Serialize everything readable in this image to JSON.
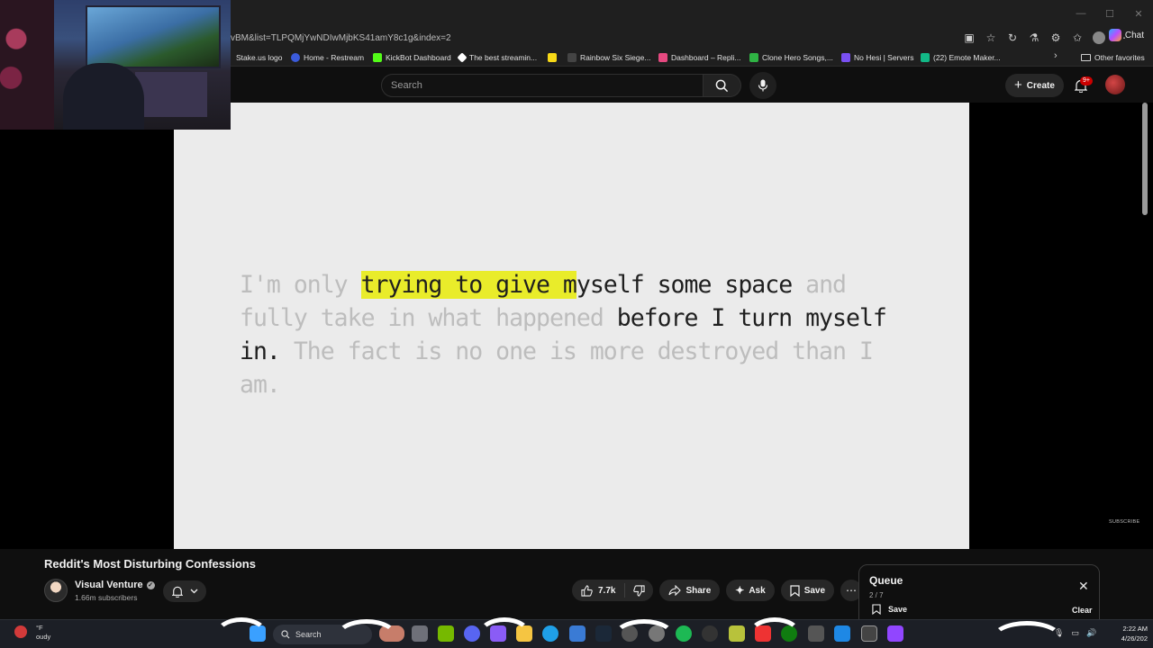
{
  "browser": {
    "url_text": "vBM&list=TLPQMjYwNDIwMjbKS41amY8c1g&index=2",
    "chat_label": "Chat",
    "bookmarks": [
      {
        "label": "Stake.us logo",
        "color": "#1f1f1f"
      },
      {
        "label": "Home - Restream",
        "color": "#3b5bdb"
      },
      {
        "label": "KickBot Dashboard",
        "color": "#53fc18"
      },
      {
        "label": "The best streamin...",
        "color": "#ffffff"
      },
      {
        "label": "",
        "color": "#f7d917"
      },
      {
        "label": "Rainbow Six Siege...",
        "color": "#444444"
      },
      {
        "label": "Dashboard – Repli...",
        "color": "#e64980"
      },
      {
        "label": "Clone Hero Songs,...",
        "color": "#2fb344"
      },
      {
        "label": "No Hesi | Servers",
        "color": "#7950f2"
      },
      {
        "label": "(22) Emote Maker...",
        "color": "#12b886"
      }
    ],
    "other_favorites": "Other favorites"
  },
  "youtube": {
    "search_placeholder": "Search",
    "create_label": "Create",
    "notification_count": "9+"
  },
  "video_caption": {
    "faded_1": "I'm only ",
    "highlight": "trying to give m",
    "dark_1": "yself some space",
    "faded_2": " and fully take in what happened ",
    "dark_2": "before I turn myself in.",
    "faded_3": " The fact is no one is more destroyed than I am."
  },
  "subscribe_watermark": "SUBSCRIBE",
  "video": {
    "title": "Reddit's Most Disturbing Confessions",
    "channel_name": "Visual Venture",
    "subscribers": "1.66m subscribers",
    "likes": "7.7k",
    "share_label": "Share",
    "ask_label": "Ask",
    "save_label": "Save"
  },
  "queue": {
    "title": "Queue",
    "position": "2 / 7",
    "save_label": "Save",
    "clear_label": "Clear"
  },
  "taskbar": {
    "weather_temp": "°F",
    "weather_desc": "oudy",
    "search_label": "Search",
    "time": "2:22 AM",
    "date": "4/26/202"
  }
}
